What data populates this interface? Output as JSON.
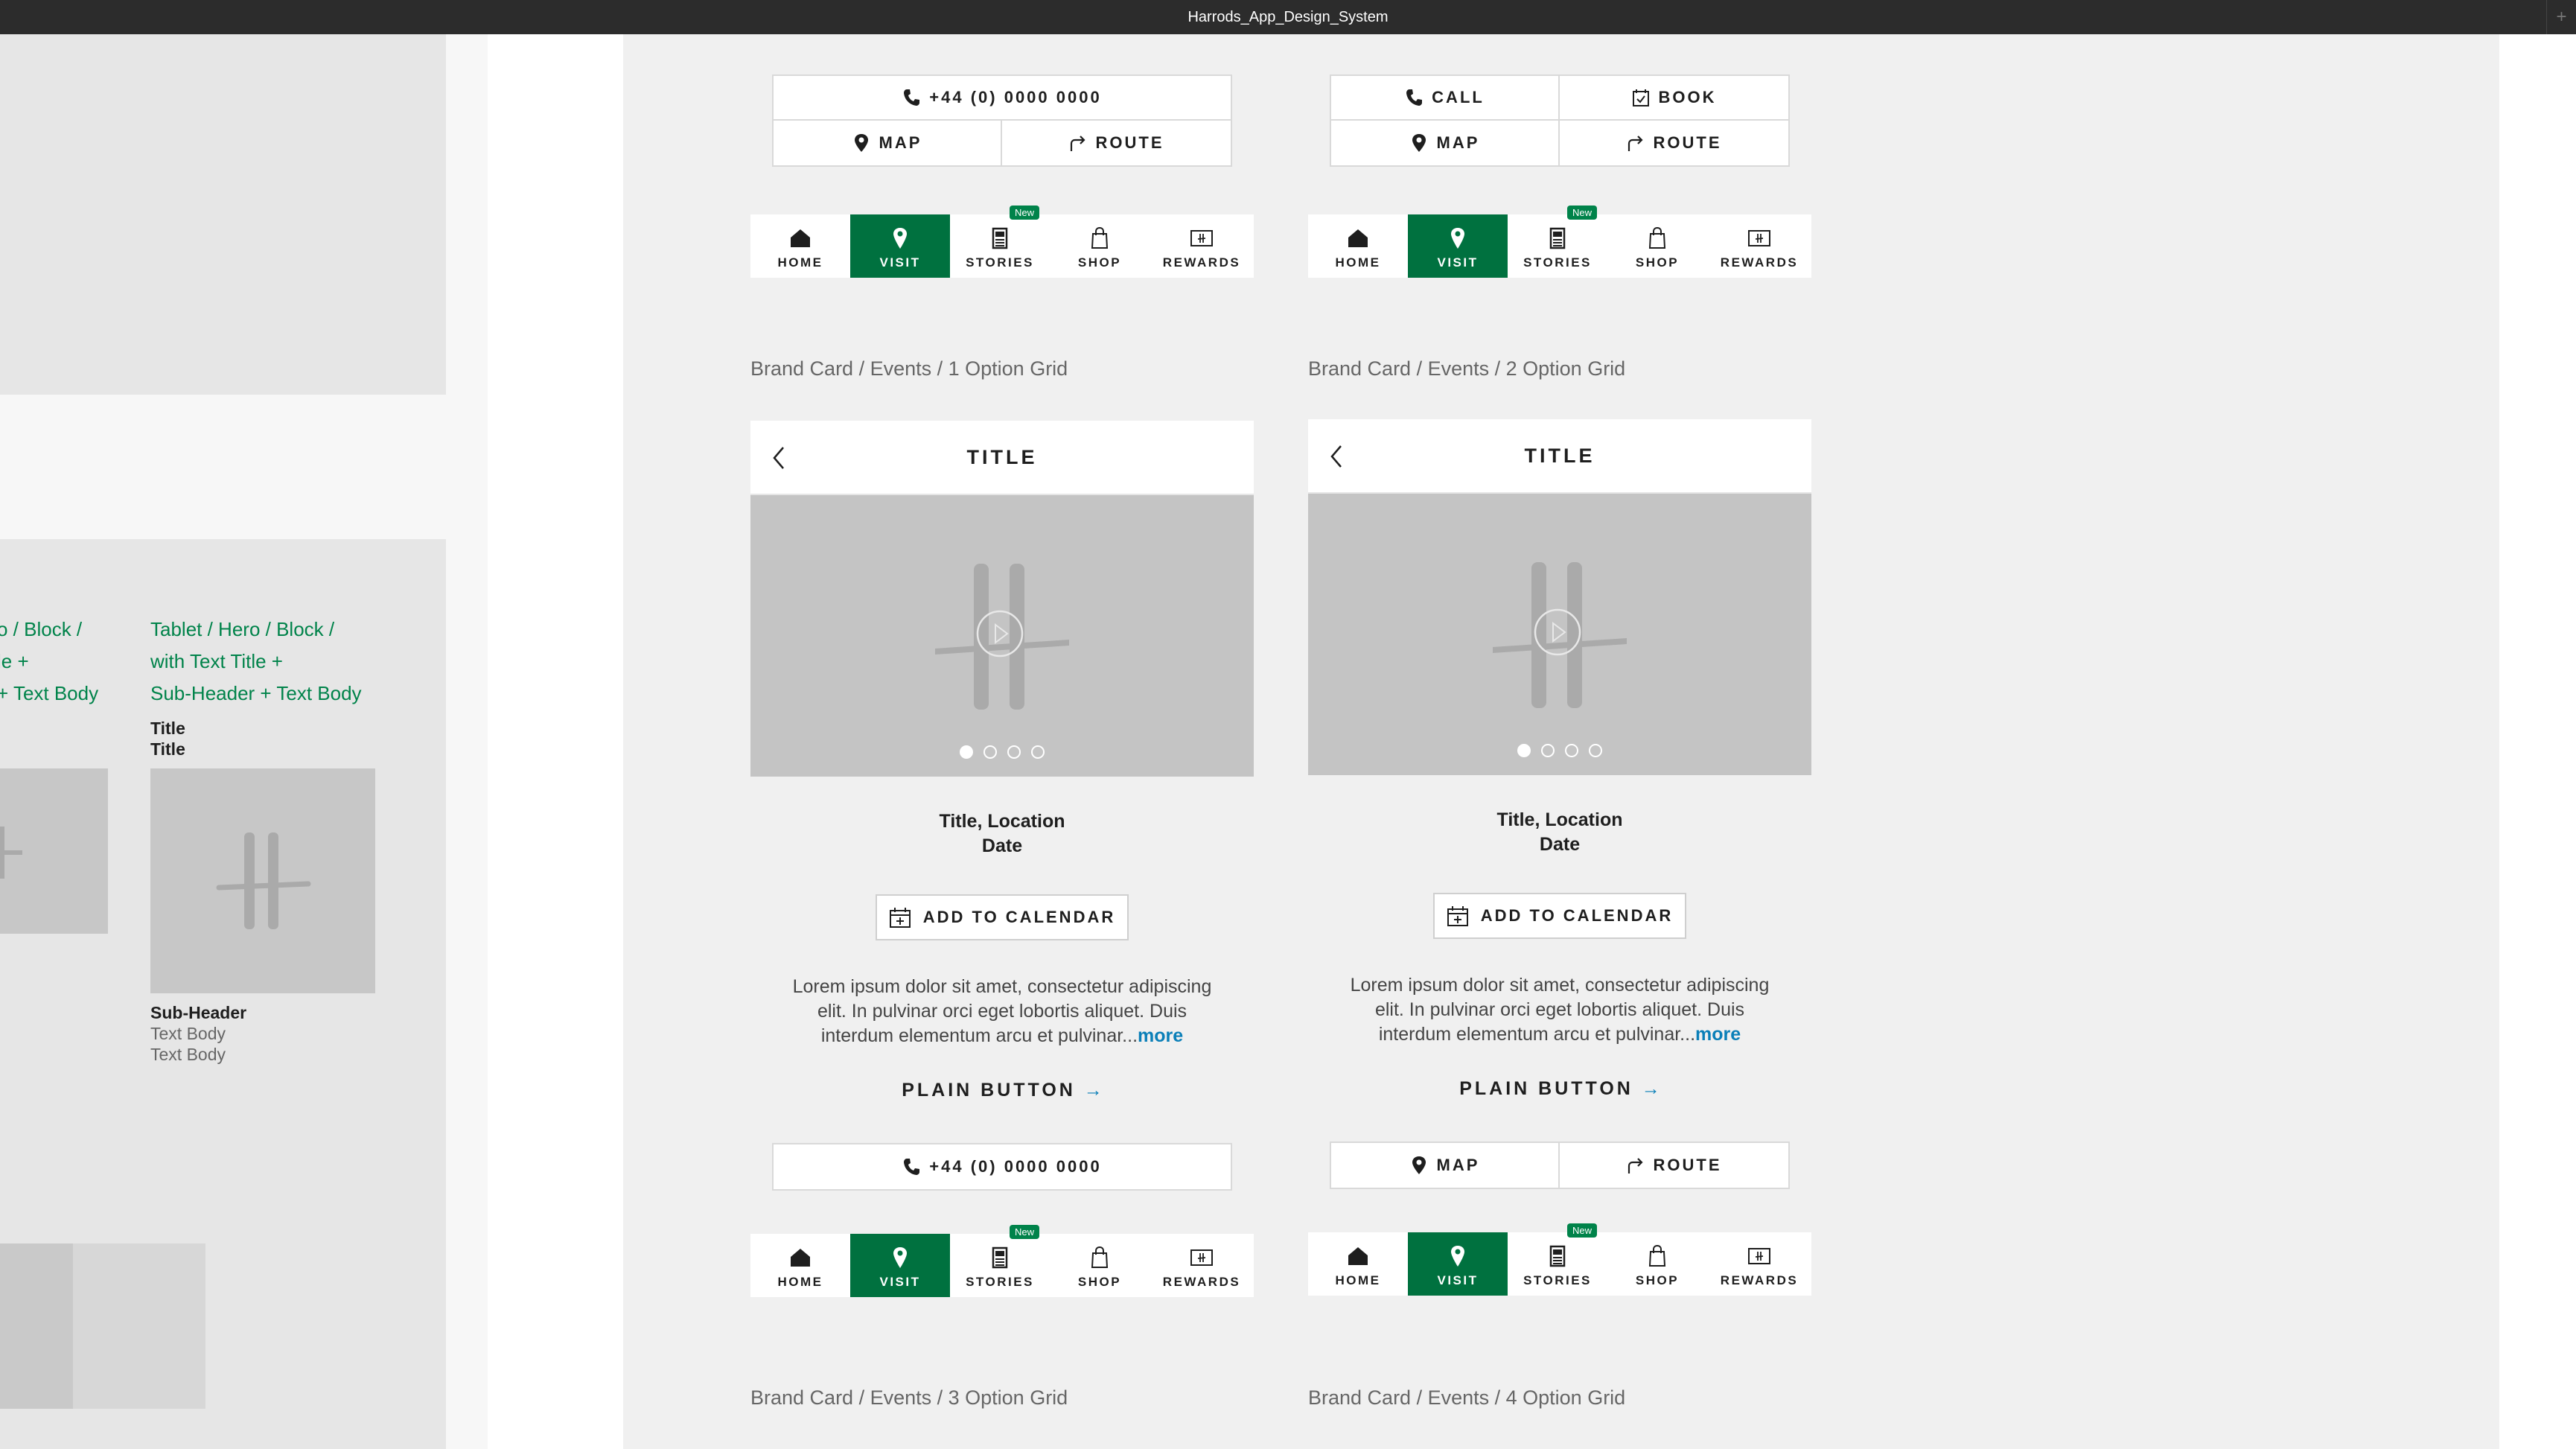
{
  "window": {
    "title": "Harrods_App_Design_System"
  },
  "left_panel": {
    "hero_label_partial": [
      "o / Block /",
      "le +",
      "+ Text Body"
    ],
    "hero_label": [
      "Tablet / Hero / Block /",
      "with Text Title +",
      "Sub-Header + Text Body"
    ],
    "title_lines": [
      "Title",
      "Title"
    ],
    "subheader": "Sub-Header",
    "text_body_lines": [
      "Text Body",
      "Text Body"
    ]
  },
  "tab_bar": {
    "tabs": [
      {
        "label": "HOME",
        "icon": "home-icon"
      },
      {
        "label": "VISIT",
        "icon": "location-pin-icon",
        "active": true
      },
      {
        "label": "STORIES",
        "icon": "newspaper-icon",
        "badge": "New"
      },
      {
        "label": "SHOP",
        "icon": "shopping-bag-icon"
      },
      {
        "label": "REWARDS",
        "icon": "rewards-card-icon"
      }
    ]
  },
  "buttons": {
    "phone": "+44 (0) 0000 0000",
    "map": "MAP",
    "route": "ROUTE",
    "call": "CALL",
    "book": "BOOK"
  },
  "captions": {
    "grid1": "Brand Card / Events / 1 Option Grid",
    "grid2": "Brand Card / Events / 2 Option Grid",
    "grid3": "Brand Card / Events / 3 Option Grid",
    "grid4": "Brand Card / Events / 4 Option Grid"
  },
  "card": {
    "header_title": "TITLE",
    "info_line1": "Title, Location",
    "info_line2": "Date",
    "calendar_button": "ADD TO CALENDAR",
    "body_line1": "Lorem ipsum dolor sit amet, consectetur adipiscing",
    "body_line2": "elit. In pulvinar orci eget lobortis aliquet. Duis",
    "body_line3": "interdum elementum arcu et pulvinar...",
    "more_link": "more",
    "plain_button": "PLAIN BUTTON",
    "plain_button_arrow": "→",
    "carousel_pages": 4,
    "carousel_active_index": 0
  },
  "colors": {
    "brand_green": "#00713f",
    "link_blue": "#0a7fb8",
    "placeholder_gray": "#c4c4c4"
  }
}
